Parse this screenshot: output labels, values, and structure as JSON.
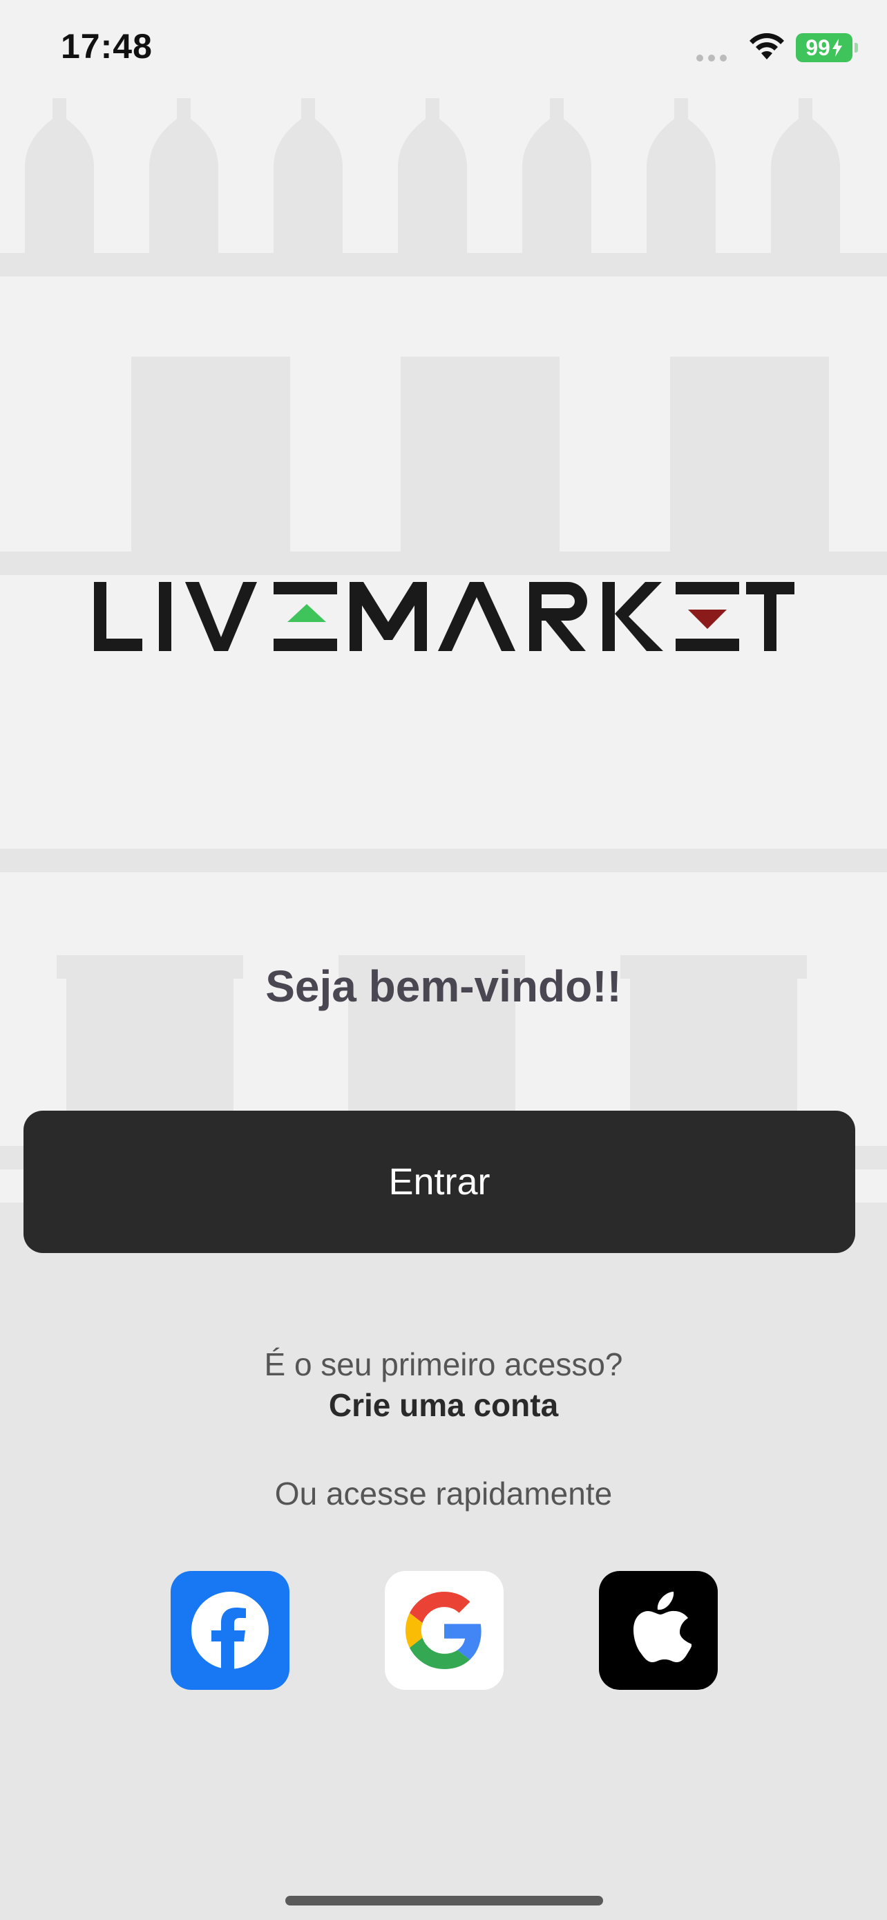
{
  "status_bar": {
    "time": "17:48",
    "battery": "99",
    "battery_color": "#3ec45a"
  },
  "brand": {
    "name": "LIVEMARKET",
    "up_triangle_color": "#3ec45a",
    "down_triangle_color": "#8b1a1a"
  },
  "welcome": {
    "title": "Seja bem-vindo!!"
  },
  "login": {
    "enter_label": "Entrar",
    "first_access_text": "É o seu primeiro acesso?",
    "create_account_label": "Crie uma conta",
    "quick_access_text": "Ou acesse rapidamente"
  },
  "social": [
    {
      "icon": "facebook-icon",
      "color": "#1877f2"
    },
    {
      "icon": "google-icon",
      "color": "#ffffff"
    },
    {
      "icon": "apple-icon",
      "color": "#000000"
    }
  ],
  "colors": {
    "primary_button": "#2a2a2a",
    "background": "#e6e6e6",
    "welcome_text": "#4a4652"
  }
}
